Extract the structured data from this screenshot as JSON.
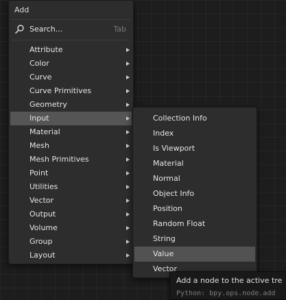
{
  "add_menu": {
    "title": "Add",
    "search": {
      "label": "Search...",
      "shortcut": "Tab",
      "icon": "search-icon"
    },
    "items": [
      {
        "label": "Attribute",
        "has_submenu": true
      },
      {
        "label": "Color",
        "has_submenu": true
      },
      {
        "label": "Curve",
        "has_submenu": true
      },
      {
        "label": "Curve Primitives",
        "has_submenu": true
      },
      {
        "label": "Geometry",
        "has_submenu": true
      },
      {
        "label": "Input",
        "has_submenu": true,
        "active": true
      },
      {
        "label": "Material",
        "has_submenu": true
      },
      {
        "label": "Mesh",
        "has_submenu": true
      },
      {
        "label": "Mesh Primitives",
        "has_submenu": true
      },
      {
        "label": "Point",
        "has_submenu": true
      },
      {
        "label": "Utilities",
        "has_submenu": true
      },
      {
        "label": "Vector",
        "has_submenu": true
      },
      {
        "label": "Output",
        "has_submenu": true
      },
      {
        "label": "Volume",
        "has_submenu": true
      },
      {
        "label": "Group",
        "has_submenu": true
      },
      {
        "label": "Layout",
        "has_submenu": true
      }
    ]
  },
  "input_submenu": {
    "items": [
      {
        "label": "Collection Info"
      },
      {
        "label": "Index"
      },
      {
        "label": "Is Viewport"
      },
      {
        "label": "Material"
      },
      {
        "label": "Normal"
      },
      {
        "label": "Object Info"
      },
      {
        "label": "Position"
      },
      {
        "label": "Random Float"
      },
      {
        "label": "String"
      },
      {
        "label": "Value",
        "highlighted": true
      },
      {
        "label": "Vector"
      }
    ]
  },
  "tooltip": {
    "description": "Add a node to the active tre",
    "python": "Python: bpy.ops.node.add"
  },
  "colors": {
    "menu_background": "#2d2d2d",
    "active_item": "#555555",
    "highlighted_item": "#525252",
    "text": "#e6e6e6",
    "shortcut_text": "#7a7a7a",
    "canvas_background": "#1d1d1d"
  }
}
